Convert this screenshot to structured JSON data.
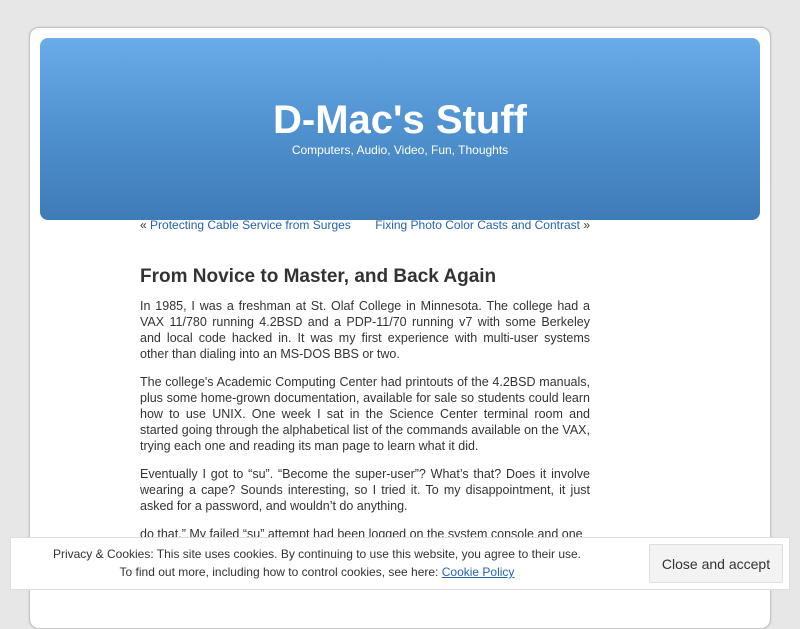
{
  "header": {
    "title": "D-Mac's Stuff",
    "description": "Computers, Audio, Video, Fun, Thoughts"
  },
  "nav": {
    "prev_arrow": "«",
    "prev_label": "Protecting Cable Service from Surges",
    "next_label": "Fixing Photo Color Casts and Contrast",
    "next_arrow": "»"
  },
  "post": {
    "title": "From Novice to Master, and Back Again",
    "paragraphs": [
      "In 1985, I was a freshman at St. Olaf College in Minnesota. The college had a VAX 11/780 running 4.2BSD and a PDP-11/70 running v7 with some Berkeley and local code hacked in. It was my first experience with multi-user systems other than dialing into an MS-DOS BBS or two.",
      "The college's Academic Computing Center had printouts of the 4.2BSD manuals, plus some home-grown documentation, available for sale so students could learn how to use UNIX. One week I sat in the Science Center terminal room and started going through the alphabetical list of the commands available on the VAX, trying each one and reading its man page to learn what it did.",
      "Eventually I got to “su”. “Become the super-user”? What’s that? Does it involve wearing a cape? Sounds interesting, so I tried it. To my disappointment, it just asked for a password, and wouldn’t do anything.",
      "do that.” My failed “su” attempt had been logged on the system console and one"
    ]
  },
  "cookie": {
    "line1": "Privacy & Cookies: This site uses cookies. By continuing to use this website, you agree to their use.",
    "line2_prefix": "To find out more, including how to control cookies, see here: ",
    "policy_link": "Cookie Policy",
    "accept_label": "Close and accept"
  }
}
